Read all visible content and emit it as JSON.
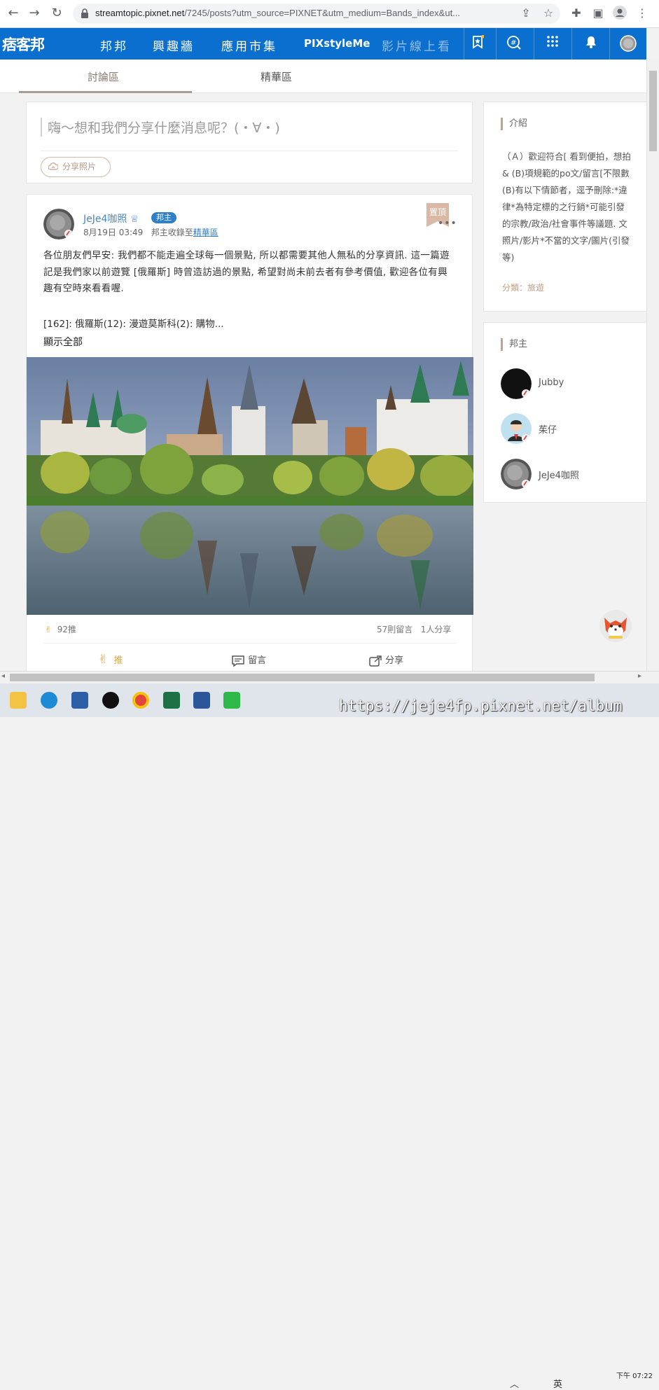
{
  "browser": {
    "url_host": "streamtopic.pixnet.net",
    "url_rest": "/7245/posts?utm_source=PIXNET&utm_medium=Bands_index&ut..."
  },
  "site": {
    "logo": "痞客邦",
    "nav": [
      "邦邦",
      "興趣牆",
      "應用市集",
      "PIXstyleMe",
      "影片線上看"
    ]
  },
  "tabs": [
    "討論區",
    "精華區"
  ],
  "compose": {
    "placeholder": "嗨～想和我們分享什麼消息呢？(・∀・)",
    "share_photo": "分享照片"
  },
  "post": {
    "author": "JeJe4咖照",
    "role_badge": "邦主",
    "date": "8月19日 03:49",
    "collected_prefix": "邦主收錄至",
    "collected_link": "精華區",
    "pin_label": "置頂",
    "body": "各位朋友們早安: 我們都不能走遍全球每一個景點, 所以都需要其他人無私的分享資訊. 這一篇遊記是我們家以前遊覽 [俄羅斯] 時曾造訪過的景點, 希望對尚未前去者有參考價值, 歡迎各位有興趣有空時來看看喔.",
    "tags": "[162]: 俄羅斯(12): 漫遊莫斯科(2): 購物...",
    "show_all": "顯示全部",
    "likes": "92推",
    "comments": "57則留言",
    "shares": "1人分享",
    "actions": {
      "like": "推",
      "comment": "留言",
      "share": "分享"
    }
  },
  "sidebar": {
    "intro_title": "介紹",
    "intro_lines": [
      "（Ａ）歡迎符合[ 看到便拍，想拍",
      "& (B)項規範的po文/留言[不限數",
      "(B)有以下情節者，逕予刪除:*違",
      "律*為特定標的之行銷*可能引發",
      "的宗教/政治/社會事件等議題. 文",
      "照片/影片*不當的文字/圖片(引發",
      "等)"
    ],
    "category": "分類：旅遊",
    "owners_title": "邦主",
    "owners": [
      "Jubby",
      "茱仔",
      "JeJe4咖照"
    ]
  },
  "taskbar": {
    "ime": "英",
    "time_top": "下午 07:22",
    "watermark": "https://jeje4fp.pixnet.net/album"
  },
  "colors": {
    "brand_blue": "#0a6fce",
    "accent": "#c7a08d",
    "like_orange": "#e4a43c"
  }
}
